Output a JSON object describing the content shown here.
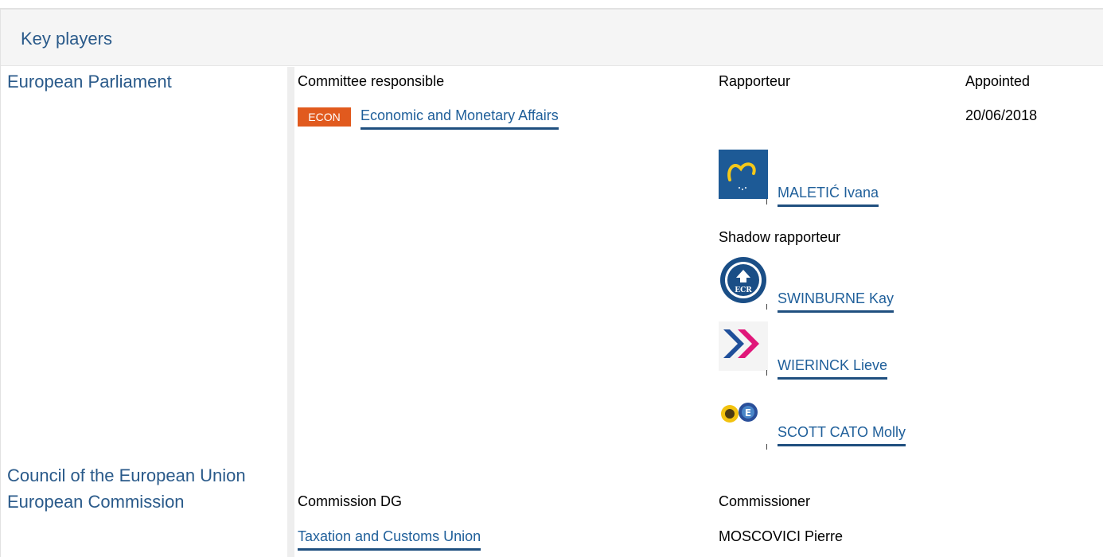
{
  "section": {
    "title": "Key players"
  },
  "parliament": {
    "institution": "European Parliament",
    "committee_header": "Committee responsible",
    "rapporteur_header": "Rapporteur",
    "appointed_header": "Appointed",
    "committee_badge": "ECON",
    "committee_name": "Economic and Monetary Affairs",
    "appointed_date": "20/06/2018",
    "rapporteur": {
      "name": "MALETIĆ Ivana",
      "group_icon": "epp-heart-logo"
    },
    "shadow_header": "Shadow rapporteur",
    "shadows": [
      {
        "name": "SWINBURNE Kay",
        "group_icon": "ecr-logo"
      },
      {
        "name": "WIERINCK Lieve",
        "group_icon": "alde-chevrons-logo"
      },
      {
        "name": "SCOTT CATO Molly",
        "group_icon": "greens-sunflower-logo"
      }
    ]
  },
  "council": {
    "institution": "Council of the European Union"
  },
  "commission": {
    "institution": "European Commission",
    "dg_header": "Commission DG",
    "commissioner_header": "Commissioner",
    "dg_name": "Taxation and Customs Union",
    "commissioner_name": "MOSCOVICI Pierre"
  },
  "colors": {
    "accent": "#1f5f9a",
    "badge": "#e15a1e",
    "institution_text": "#2a5a8a"
  }
}
